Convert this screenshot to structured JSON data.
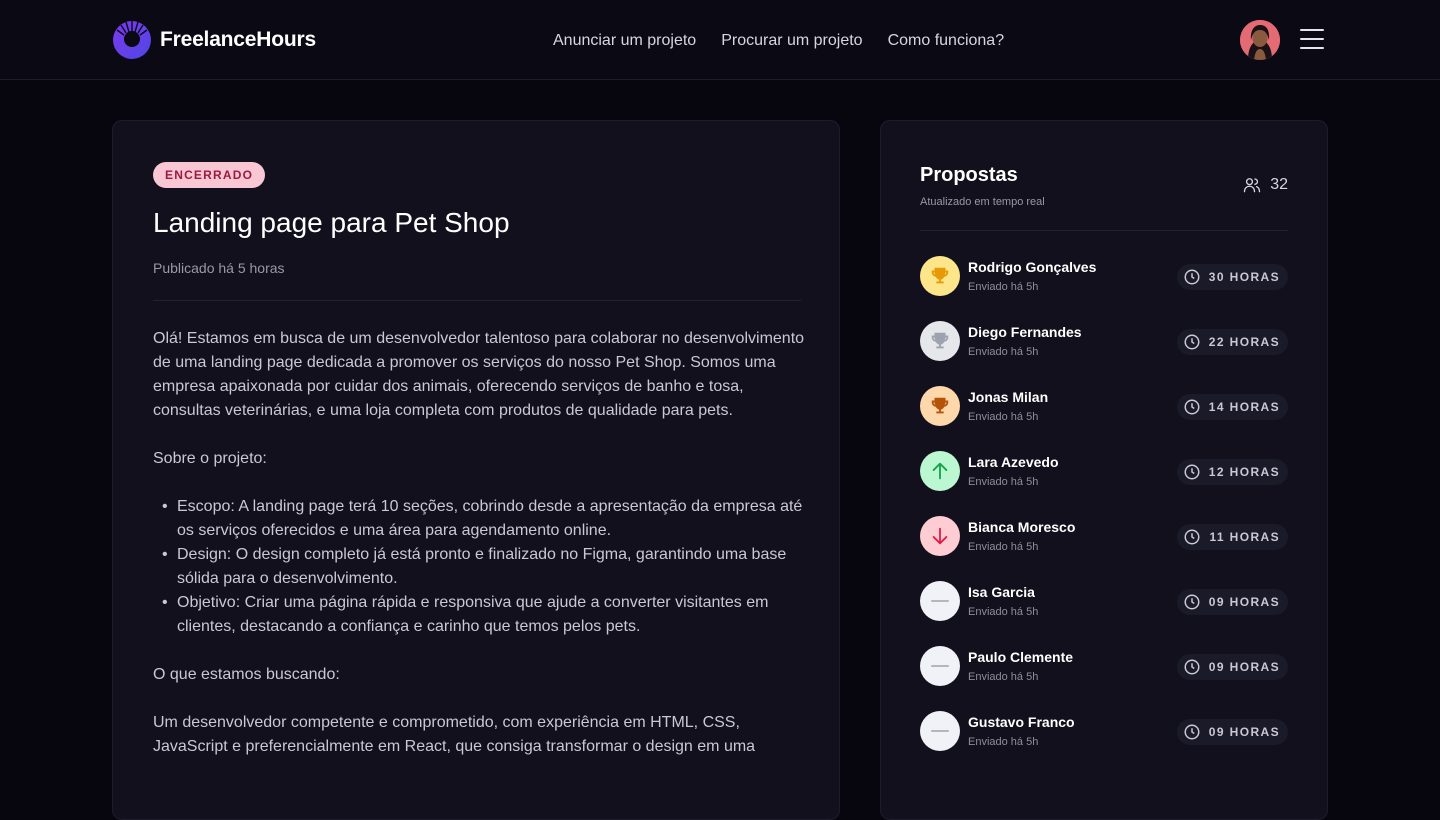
{
  "brand": {
    "name": "FreelanceHours"
  },
  "nav": [
    {
      "label": "Anunciar um projeto"
    },
    {
      "label": "Procurar um projeto"
    },
    {
      "label": "Como funciona?"
    }
  ],
  "project": {
    "status": "ENCERRADO",
    "title": "Landing page para Pet Shop",
    "published": "Publicado há 5 horas",
    "intro": "Olá! Estamos em busca de um desenvolvedor talentoso para colaborar no desenvolvimento de uma landing page dedicada a promover os serviços do nosso Pet Shop. Somos uma empresa apaixonada por cuidar dos animais, oferecendo serviços de banho e tosa, consultas veterinárias, e uma loja completa com produtos de qualidade para pets.",
    "about_heading": "Sobre o projeto:",
    "bullets": [
      "Escopo: A landing page terá 10 seções, cobrindo desde a apresentação da empresa até os serviços oferecidos e uma área para agendamento online.",
      "Design: O design completo já está pronto e finalizado no Figma, garantindo uma base sólida para o desenvolvimento.",
      "Objetivo: Criar uma página rápida e responsiva que ajude a converter visitantes em clientes, destacando a confiança e carinho que temos pelos pets."
    ],
    "looking_heading": "O que estamos buscando:",
    "looking_text": "Um desenvolvedor competente e comprometido, com experiência em HTML, CSS, JavaScript e preferencialmente em React, que consiga transformar o design em uma"
  },
  "proposals": {
    "title": "Propostas",
    "subtitle": "Atualizado em tempo real",
    "count": "32",
    "items": [
      {
        "name": "Rodrigo Gonçalves",
        "sent": "Enviado há 5h",
        "hours": "30 HORAS",
        "rank": "gold-trophy-icon"
      },
      {
        "name": "Diego Fernandes",
        "sent": "Enviado há 5h",
        "hours": "22 HORAS",
        "rank": "silver-trophy-icon"
      },
      {
        "name": "Jonas Milan",
        "sent": "Enviado há 5h",
        "hours": "14 HORAS",
        "rank": "bronze-trophy-icon"
      },
      {
        "name": "Lara Azevedo",
        "sent": "Enviado há 5h",
        "hours": "12 HORAS",
        "rank": "arrow-up-icon"
      },
      {
        "name": "Bianca Moresco",
        "sent": "Enviado há 5h",
        "hours": "11 HORAS",
        "rank": "arrow-down-icon"
      },
      {
        "name": "Isa Garcia",
        "sent": "Enviado há 5h",
        "hours": "09 HORAS",
        "rank": "minus-icon"
      },
      {
        "name": "Paulo Clemente",
        "sent": "Enviado há 5h",
        "hours": "09 HORAS",
        "rank": "minus-icon"
      },
      {
        "name": "Gustavo Franco",
        "sent": "Enviado há 5h",
        "hours": "09 HORAS",
        "rank": "minus-icon"
      }
    ]
  },
  "colors": {
    "background": "#07060f",
    "card": "#11101c",
    "badge_bg": "#f9c7d3",
    "badge_text": "#9b1b3f",
    "gold": "#fde68a",
    "silver": "#e5e7eb",
    "bronze": "#fed7aa",
    "up": "#bbf7d0",
    "down": "#fecdd3",
    "neutral": "#f1f2f7"
  }
}
